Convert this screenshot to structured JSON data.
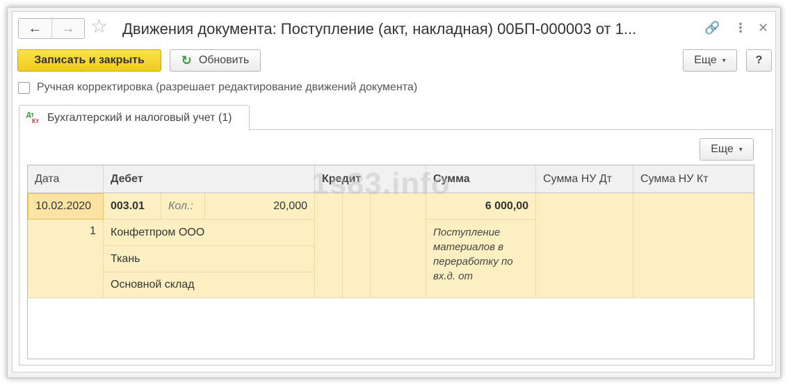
{
  "window": {
    "title": "Движения документа: Поступление (акт, накладная) 00БП-000003 от 1...",
    "nav_back_icon": "arrow-left-icon",
    "nav_forward_icon": "arrow-right-icon",
    "favorite_icon": "star-icon",
    "link_icon": "link-icon",
    "menu_icon": "kebab-menu-icon",
    "close_icon": "close-icon"
  },
  "toolbar": {
    "save_close_label": "Записать и закрыть",
    "refresh_label": "Обновить",
    "more_label": "Еще",
    "help_label": "?"
  },
  "manual_edit": {
    "label": "Ручная корректировка (разрешает редактирование движений документа)",
    "checked": false
  },
  "tabs": [
    {
      "label": "Бухгалтерский и налоговый учет (1)",
      "icon": "dt-kt-icon",
      "active": true
    }
  ],
  "table_toolbar": {
    "more_label": "Еще"
  },
  "table": {
    "columns": [
      "Дата",
      "Дебет",
      "Кредит",
      "Сумма",
      "Сумма НУ Дт",
      "Сумма НУ Кт"
    ],
    "rows": [
      {
        "date": "10.02.2020",
        "line_no": "1",
        "debit_account": "003.01",
        "qty_label": "Кол.:",
        "qty_value": "20,000",
        "debit_subconto": [
          "Конфетпром ООО",
          "Ткань",
          "Основной склад"
        ],
        "amount": "6 000,00",
        "content": "Поступление материалов в переработку по вх.д.  от"
      }
    ]
  },
  "watermark": "1s83.info",
  "colors": {
    "accent_button": "#f5d327",
    "row_highlight": "#fcf0c2",
    "refresh_icon": "#3a9a36"
  }
}
